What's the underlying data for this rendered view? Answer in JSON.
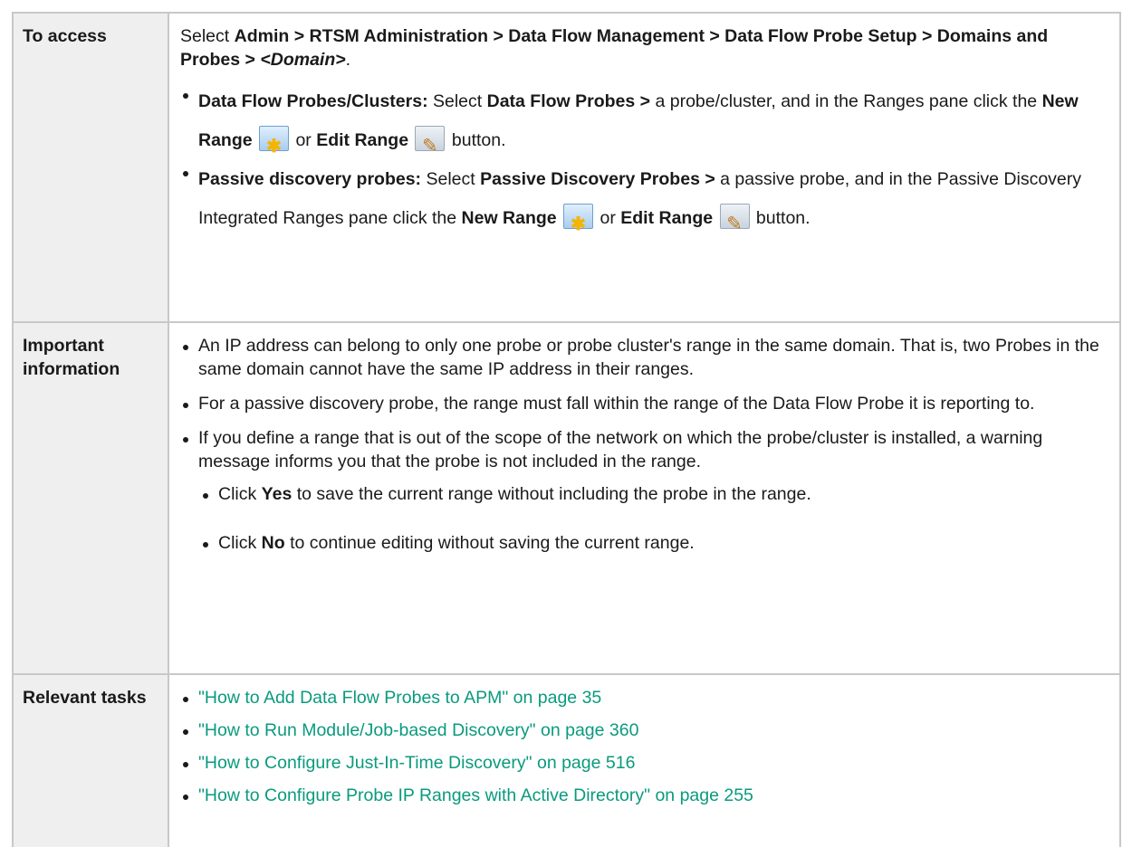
{
  "rows": {
    "access": {
      "header": "To access",
      "intro": {
        "select": "Select ",
        "path": "Admin > RTSM Administration > Data Flow Management > Data Flow Probe Setup > Domains and Probes > ",
        "domain": "<Domain>",
        "gt_end": ">",
        "period": "."
      },
      "bullet1": {
        "label": "Data Flow Probes/Clusters:",
        "t1": " Select ",
        "b1": "Data Flow Probes >",
        "t2": " a probe/cluster, and in the Ranges pane click the ",
        "new_range": "New Range",
        "or": " or ",
        "edit_range": "Edit Range",
        "button": " button."
      },
      "bullet2": {
        "label": "Passive discovery probes:",
        "t1": " Select ",
        "b1": "Passive Discovery Probes >",
        "t2": " a passive probe, and in the Passive Discovery Integrated Ranges pane click the ",
        "new_range": "New Range",
        "or": " or ",
        "edit_range": "Edit Range",
        "button": " button."
      },
      "icons": {
        "new": "new-range-star-icon",
        "edit": "edit-range-pencil-icon"
      }
    },
    "important": {
      "header": "Important information",
      "item1": "An IP address can belong to only one probe or probe cluster's range in the same domain. That is, two Probes in the same domain cannot have the same IP address in their ranges.",
      "item2": "For a passive discovery probe, the range must fall within the range of the Data Flow Probe it is reporting to.",
      "item3": "If you define a range that is out of the scope of the network on which the probe/cluster is installed, a warning message informs you that the probe is not included in the range.",
      "sub1": {
        "click": "Click ",
        "yes": "Yes",
        "rest": " to save the current range without including the probe in the range."
      },
      "sub2": {
        "click": "Click ",
        "no": "No",
        "rest": " to continue editing without saving the current range."
      }
    },
    "tasks": {
      "header": "Relevant tasks",
      "links": [
        "\"How to Add Data Flow Probes to APM\" on page 35",
        "\"How to Run Module/Job-based Discovery\" on page 360",
        "\"How to Configure Just-In-Time Discovery\" on page 516",
        "\"How to Configure Probe IP Ranges with Active Directory\" on page 255"
      ]
    }
  },
  "colors": {
    "link": "#0a9a7e",
    "header_bg": "#efefef",
    "border": "#c8c8c8"
  }
}
